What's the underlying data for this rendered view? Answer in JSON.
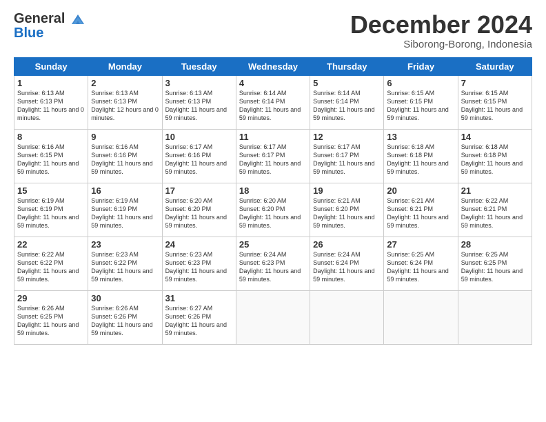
{
  "header": {
    "logo_line1": "General",
    "logo_line2": "Blue",
    "month": "December 2024",
    "location": "Siborong-Borong, Indonesia"
  },
  "weekdays": [
    "Sunday",
    "Monday",
    "Tuesday",
    "Wednesday",
    "Thursday",
    "Friday",
    "Saturday"
  ],
  "weeks": [
    [
      {
        "day": "1",
        "sunrise": "6:13 AM",
        "sunset": "6:13 PM",
        "daylight": "11 hours and 0 minutes"
      },
      {
        "day": "2",
        "sunrise": "6:13 AM",
        "sunset": "6:13 PM",
        "daylight": "12 hours and 0 minutes"
      },
      {
        "day": "3",
        "sunrise": "6:13 AM",
        "sunset": "6:13 PM",
        "daylight": "11 hours and 59 minutes"
      },
      {
        "day": "4",
        "sunrise": "6:14 AM",
        "sunset": "6:14 PM",
        "daylight": "11 hours and 59 minutes"
      },
      {
        "day": "5",
        "sunrise": "6:14 AM",
        "sunset": "6:14 PM",
        "daylight": "11 hours and 59 minutes"
      },
      {
        "day": "6",
        "sunrise": "6:15 AM",
        "sunset": "6:15 PM",
        "daylight": "11 hours and 59 minutes"
      },
      {
        "day": "7",
        "sunrise": "6:15 AM",
        "sunset": "6:15 PM",
        "daylight": "11 hours and 59 minutes"
      }
    ],
    [
      {
        "day": "8",
        "sunrise": "6:16 AM",
        "sunset": "6:15 PM",
        "daylight": "11 hours and 59 minutes"
      },
      {
        "day": "9",
        "sunrise": "6:16 AM",
        "sunset": "6:16 PM",
        "daylight": "11 hours and 59 minutes"
      },
      {
        "day": "10",
        "sunrise": "6:17 AM",
        "sunset": "6:16 PM",
        "daylight": "11 hours and 59 minutes"
      },
      {
        "day": "11",
        "sunrise": "6:17 AM",
        "sunset": "6:17 PM",
        "daylight": "11 hours and 59 minutes"
      },
      {
        "day": "12",
        "sunrise": "6:17 AM",
        "sunset": "6:17 PM",
        "daylight": "11 hours and 59 minutes"
      },
      {
        "day": "13",
        "sunrise": "6:18 AM",
        "sunset": "6:18 PM",
        "daylight": "11 hours and 59 minutes"
      },
      {
        "day": "14",
        "sunrise": "6:18 AM",
        "sunset": "6:18 PM",
        "daylight": "11 hours and 59 minutes"
      }
    ],
    [
      {
        "day": "15",
        "sunrise": "6:19 AM",
        "sunset": "6:19 PM",
        "daylight": "11 hours and 59 minutes"
      },
      {
        "day": "16",
        "sunrise": "6:19 AM",
        "sunset": "6:19 PM",
        "daylight": "11 hours and 59 minutes"
      },
      {
        "day": "17",
        "sunrise": "6:20 AM",
        "sunset": "6:20 PM",
        "daylight": "11 hours and 59 minutes"
      },
      {
        "day": "18",
        "sunrise": "6:20 AM",
        "sunset": "6:20 PM",
        "daylight": "11 hours and 59 minutes"
      },
      {
        "day": "19",
        "sunrise": "6:21 AM",
        "sunset": "6:20 PM",
        "daylight": "11 hours and 59 minutes"
      },
      {
        "day": "20",
        "sunrise": "6:21 AM",
        "sunset": "6:21 PM",
        "daylight": "11 hours and 59 minutes"
      },
      {
        "day": "21",
        "sunrise": "6:22 AM",
        "sunset": "6:21 PM",
        "daylight": "11 hours and 59 minutes"
      }
    ],
    [
      {
        "day": "22",
        "sunrise": "6:22 AM",
        "sunset": "6:22 PM",
        "daylight": "11 hours and 59 minutes"
      },
      {
        "day": "23",
        "sunrise": "6:23 AM",
        "sunset": "6:22 PM",
        "daylight": "11 hours and 59 minutes"
      },
      {
        "day": "24",
        "sunrise": "6:23 AM",
        "sunset": "6:23 PM",
        "daylight": "11 hours and 59 minutes"
      },
      {
        "day": "25",
        "sunrise": "6:24 AM",
        "sunset": "6:23 PM",
        "daylight": "11 hours and 59 minutes"
      },
      {
        "day": "26",
        "sunrise": "6:24 AM",
        "sunset": "6:24 PM",
        "daylight": "11 hours and 59 minutes"
      },
      {
        "day": "27",
        "sunrise": "6:25 AM",
        "sunset": "6:24 PM",
        "daylight": "11 hours and 59 minutes"
      },
      {
        "day": "28",
        "sunrise": "6:25 AM",
        "sunset": "6:25 PM",
        "daylight": "11 hours and 59 minutes"
      }
    ],
    [
      {
        "day": "29",
        "sunrise": "6:26 AM",
        "sunset": "6:25 PM",
        "daylight": "11 hours and 59 minutes"
      },
      {
        "day": "30",
        "sunrise": "6:26 AM",
        "sunset": "6:26 PM",
        "daylight": "11 hours and 59 minutes"
      },
      {
        "day": "31",
        "sunrise": "6:27 AM",
        "sunset": "6:26 PM",
        "daylight": "11 hours and 59 minutes"
      },
      null,
      null,
      null,
      null
    ]
  ]
}
